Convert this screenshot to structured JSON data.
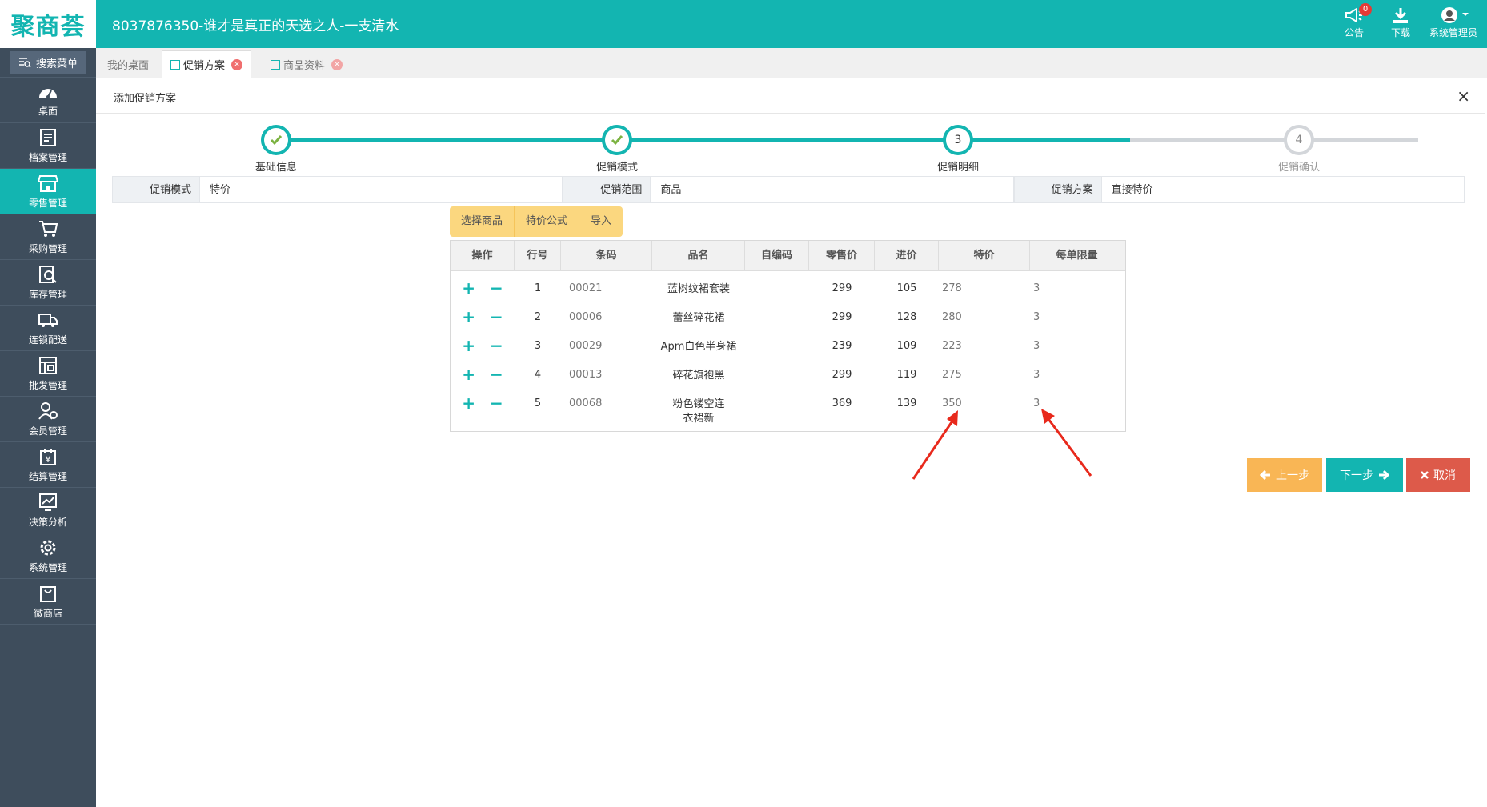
{
  "header": {
    "logo": "聚商荟",
    "store_title": "8037876350-谁才是真正的天选之人-一支清水",
    "announce_label": "公告",
    "announce_badge": "0",
    "download_label": "下载",
    "user_label": "系统管理员"
  },
  "sidebar": {
    "search_label": "搜索菜单",
    "items": [
      {
        "label": "桌面",
        "icon": "dashboard-icon"
      },
      {
        "label": "档案管理",
        "icon": "archive-icon"
      },
      {
        "label": "零售管理",
        "icon": "store-icon"
      },
      {
        "label": "采购管理",
        "icon": "cart-icon"
      },
      {
        "label": "库存管理",
        "icon": "inventory-search-icon"
      },
      {
        "label": "连锁配送",
        "icon": "truck-icon"
      },
      {
        "label": "批发管理",
        "icon": "wholesale-icon"
      },
      {
        "label": "会员管理",
        "icon": "member-icon"
      },
      {
        "label": "结算管理",
        "icon": "settlement-icon"
      },
      {
        "label": "决策分析",
        "icon": "chart-icon"
      },
      {
        "label": "系统管理",
        "icon": "gear-icon"
      },
      {
        "label": "微商店",
        "icon": "shop-bag-icon"
      }
    ],
    "active_index": 2
  },
  "tabs": [
    {
      "label": "我的桌面"
    },
    {
      "label": "促销方案"
    },
    {
      "label": "商品资料"
    }
  ],
  "dialog": {
    "title": "添加促销方案",
    "close": "×"
  },
  "steps": [
    {
      "label": "基础信息",
      "number": "1",
      "state": "done"
    },
    {
      "label": "促销模式",
      "number": "2",
      "state": "done"
    },
    {
      "label": "促销明细",
      "number": "3",
      "state": "current"
    },
    {
      "label": "促销确认",
      "number": "4",
      "state": "pending"
    }
  ],
  "info": {
    "mode_label": "促销模式",
    "mode_value": "特价",
    "scope_label": "促销范围",
    "scope_value": "商品",
    "plan_label": "促销方案",
    "plan_value": "直接特价"
  },
  "toolbar": {
    "select_label": "选择商品",
    "formula_label": "特价公式",
    "import_label": "导入"
  },
  "table": {
    "columns": [
      "操作",
      "行号",
      "条码",
      "品名",
      "自编码",
      "零售价",
      "进价",
      "特价",
      "每单限量"
    ],
    "rows": [
      {
        "no": "1",
        "code": "00021",
        "name": "蓝树纹裙套装",
        "self": "",
        "price": "299",
        "cost": "105",
        "special": "278",
        "limit": "3"
      },
      {
        "no": "2",
        "code": "00006",
        "name": "蕾丝碎花裙",
        "self": "",
        "price": "299",
        "cost": "128",
        "special": "280",
        "limit": "3"
      },
      {
        "no": "3",
        "code": "00029",
        "name": "Apm白色半身裙",
        "self": "",
        "price": "239",
        "cost": "109",
        "special": "223",
        "limit": "3"
      },
      {
        "no": "4",
        "code": "00013",
        "name": "碎花旗袍黑",
        "self": "",
        "price": "299",
        "cost": "119",
        "special": "275",
        "limit": "3"
      },
      {
        "no": "5",
        "code": "00068",
        "name": "粉色镂空连衣裙新",
        "self": "",
        "price": "369",
        "cost": "139",
        "special": "350",
        "limit": "3"
      }
    ]
  },
  "buttons": {
    "prev": "上一步",
    "next": "下一步",
    "cancel": "取消"
  },
  "colors": {
    "primary": "#13b5b1",
    "sidebar": "#3e4d5c",
    "prev": "#f9b655",
    "cancel": "#dd5a4a",
    "annotation": "#e8291c"
  }
}
